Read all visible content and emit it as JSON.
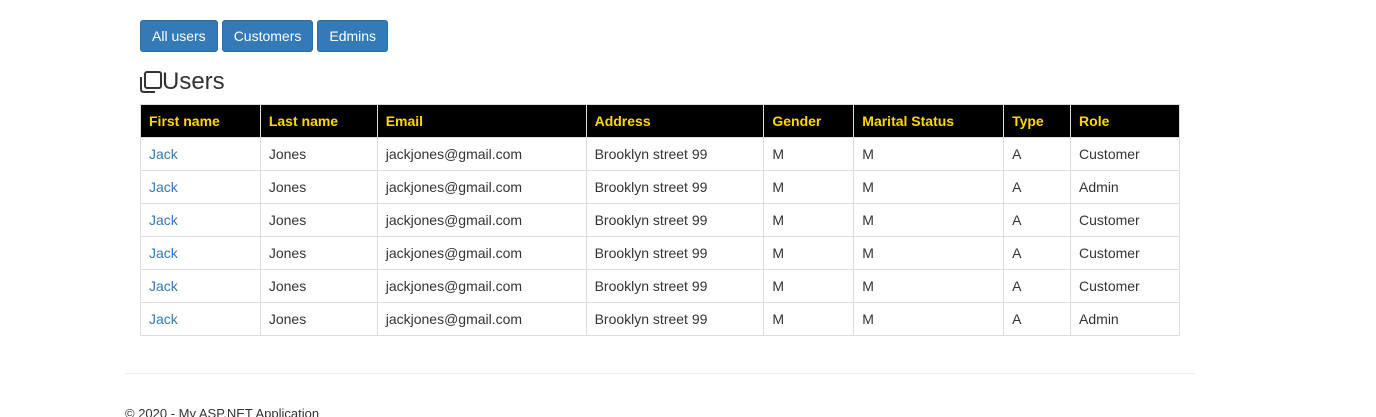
{
  "nav": {
    "buttons": [
      "All users",
      "Customers",
      "Edmins"
    ]
  },
  "header": {
    "title": "Users",
    "icon": "copy-icon"
  },
  "table": {
    "columns": [
      "First name",
      "Last name",
      "Email",
      "Address",
      "Gender",
      "Marital Status",
      "Type",
      "Role"
    ],
    "rows": [
      [
        "Jack",
        "Jones",
        "jackjones@gmail.com",
        "Brooklyn street 99",
        "M",
        "M",
        "A",
        "Customer"
      ],
      [
        "Jack",
        "Jones",
        "jackjones@gmail.com",
        "Brooklyn street 99",
        "M",
        "M",
        "A",
        "Admin"
      ],
      [
        "Jack",
        "Jones",
        "jackjones@gmail.com",
        "Brooklyn street 99",
        "M",
        "M",
        "A",
        "Customer"
      ],
      [
        "Jack",
        "Jones",
        "jackjones@gmail.com",
        "Brooklyn street 99",
        "M",
        "M",
        "A",
        "Customer"
      ],
      [
        "Jack",
        "Jones",
        "jackjones@gmail.com",
        "Brooklyn street 99",
        "M",
        "M",
        "A",
        "Customer"
      ],
      [
        "Jack",
        "Jones",
        "jackjones@gmail.com",
        "Brooklyn street 99",
        "M",
        "M",
        "A",
        "Admin"
      ]
    ]
  },
  "footer": {
    "text": "© 2020 - My ASP.NET Application"
  },
  "colors": {
    "button_bg": "#337ab7",
    "header_bg": "#000000",
    "header_text": "#ffd700",
    "link": "#337ab7"
  }
}
